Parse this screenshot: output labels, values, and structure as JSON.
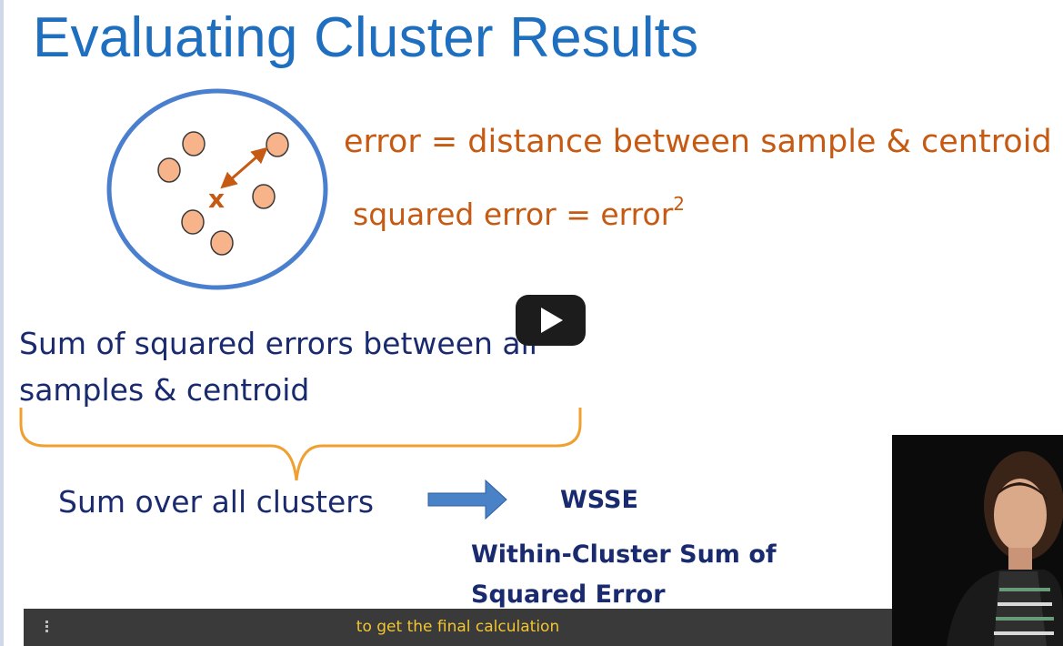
{
  "slide": {
    "title": "Evaluating Cluster Results",
    "error_definition": "error = distance between sample & centroid",
    "squared_error_text": "squared error = error",
    "squared_error_exponent": "2",
    "sse_line1": "Sum of squared errors between all",
    "sse_line2": "samples & centroid",
    "sum_over_clusters": "Sum over all clusters",
    "wsse": "WSSE",
    "wsse_line1": "Within-Cluster Sum of",
    "wsse_line2": "Squared Error",
    "diagram": {
      "centroid_label": "x",
      "colors": {
        "cluster_circle": "#4a7fd0",
        "sample_fill": "#f7b48a",
        "sample_stroke": "#3a3a3a",
        "centroid_and_arrow": "#c65a12",
        "brace": "#f0a030",
        "block_arrow": "#4a82c8"
      }
    }
  },
  "player": {
    "play_icon": "play-icon",
    "caption": "to get the final calculation",
    "caption_menu_icon": "vertical-dots-icon",
    "colors": {
      "caption_text": "#f3c531",
      "caption_bar": "#3a3a3a"
    }
  }
}
